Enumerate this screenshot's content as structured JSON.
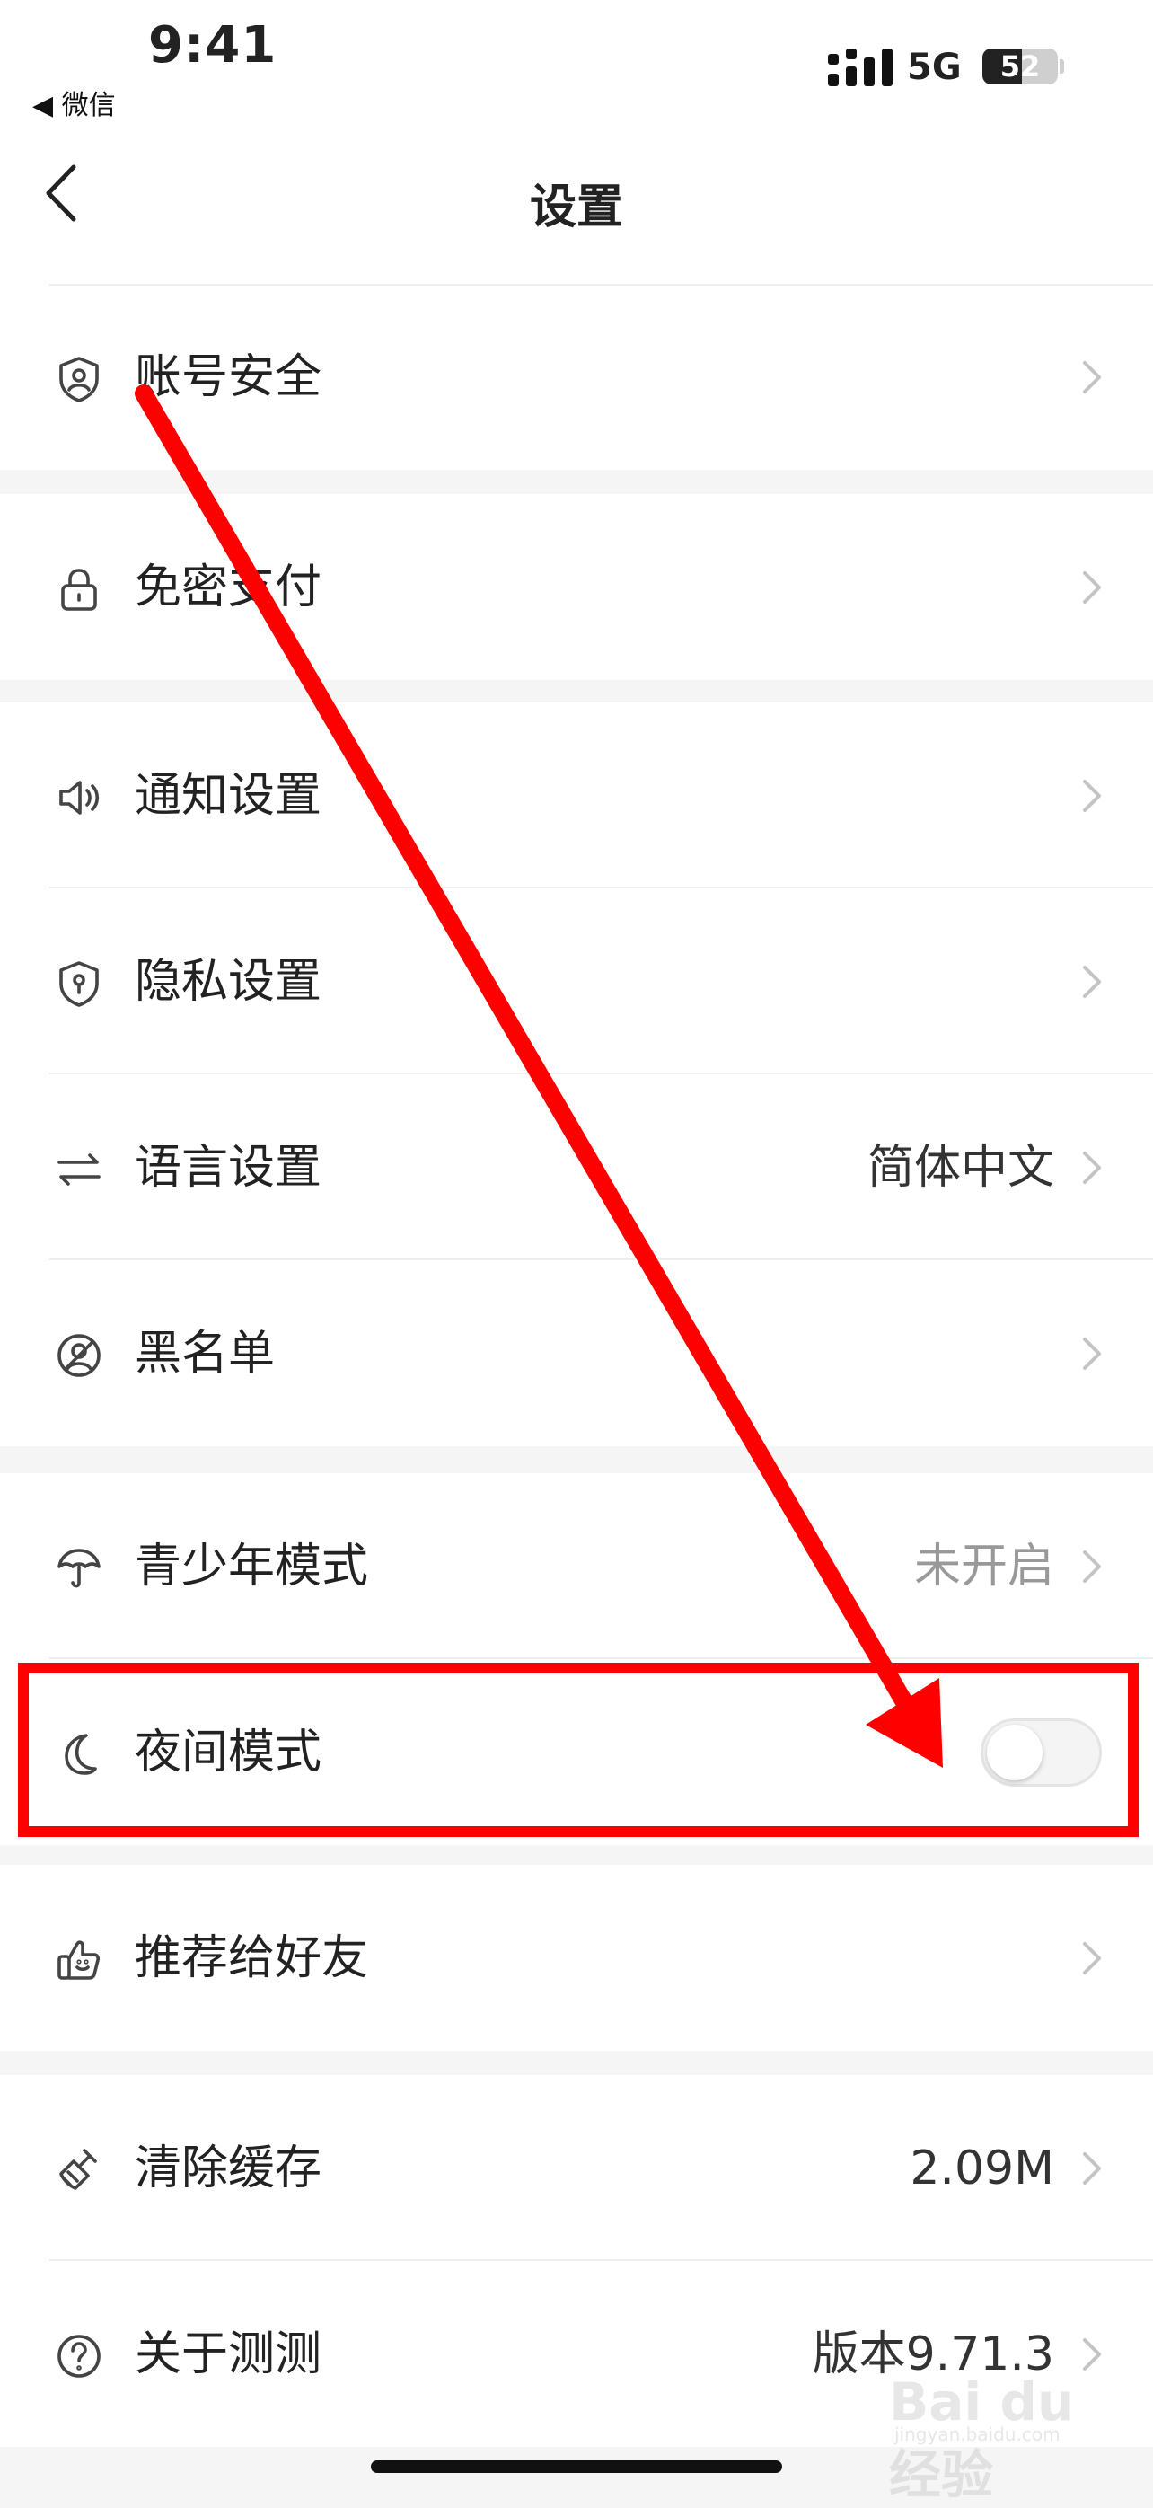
{
  "status_bar": {
    "time": "9:41",
    "back_app": "◀ 微信",
    "network": "5G",
    "battery": "52"
  },
  "header": {
    "title": "设置"
  },
  "groups": [
    [
      {
        "label": "账号安全",
        "icon": "shield-user-icon"
      }
    ],
    [
      {
        "label": "免密支付",
        "icon": "lock-icon"
      }
    ],
    [
      {
        "label": "通知设置",
        "icon": "speaker-icon"
      },
      {
        "label": "隐私设置",
        "icon": "shield-keyhole-icon"
      },
      {
        "label": "语言设置",
        "icon": "swap-arrows-icon",
        "value": "简体中文"
      },
      {
        "label": "黑名单",
        "icon": "block-user-icon"
      }
    ],
    [
      {
        "label": "青少年模式",
        "icon": "umbrella-icon",
        "value": "未开启"
      },
      {
        "label": "夜间模式",
        "icon": "moon-icon",
        "toggle": false
      }
    ],
    [
      {
        "label": "推荐给好友",
        "icon": "thumbs-up-icon"
      }
    ],
    [
      {
        "label": "清除缓存",
        "icon": "broom-icon",
        "value": "2.09M"
      },
      {
        "label": "关于测测",
        "icon": "question-icon",
        "value": "版本9.71.3"
      }
    ]
  ],
  "watermark": {
    "text": "Bai du 经验",
    "sub": "jingyan.baidu.com"
  },
  "colors": {
    "annotation": "#ff0000",
    "background": "#f5f5f5"
  }
}
